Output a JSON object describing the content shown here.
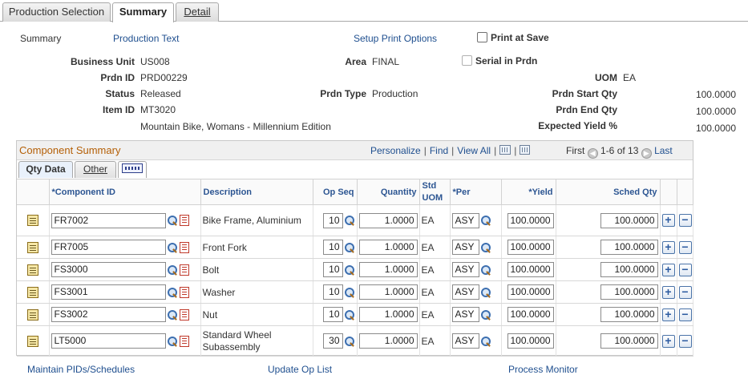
{
  "tabs": [
    {
      "label": "Production Selection",
      "active": false
    },
    {
      "label": "Summary",
      "active": true
    },
    {
      "label": "Detail",
      "active": false
    }
  ],
  "header_links": {
    "summary_label": "Summary",
    "production_text": "Production Text",
    "setup_print_options": "Setup Print Options",
    "print_at_save": "Print at Save",
    "serial_in_prdn": "Serial in Prdn"
  },
  "fields": {
    "business_unit_label": "Business Unit",
    "business_unit": "US008",
    "prdn_id_label": "Prdn ID",
    "prdn_id": "PRD00229",
    "status_label": "Status",
    "status": "Released",
    "item_id_label": "Item ID",
    "item_id": "MT3020",
    "item_description": "Mountain Bike, Womans - Millennium Edition",
    "area_label": "Area",
    "area": "FINAL",
    "prdn_type_label": "Prdn Type",
    "prdn_type": "Production",
    "uom_label": "UOM",
    "uom": "EA",
    "start_qty_label": "Prdn Start Qty",
    "start_qty": "100.0000",
    "end_qty_label": "Prdn End Qty",
    "end_qty": "100.0000",
    "yield_label": "Expected Yield %",
    "yield": "100.0000"
  },
  "grid": {
    "title": "Component Summary",
    "personalize": "Personalize",
    "find": "Find",
    "view_all": "View All",
    "first": "First",
    "range": "1-6 of 13",
    "last": "Last",
    "subtabs": [
      {
        "label": "Qty Data",
        "active": true
      },
      {
        "label": "Other",
        "active": false
      }
    ],
    "columns": {
      "component_id": "*Component ID",
      "description": "Description",
      "op_seq": "Op Seq",
      "quantity": "Quantity",
      "std_uom": "Std UOM",
      "per": "*Per",
      "yield": "*Yield",
      "sched_qty": "Sched Qty"
    },
    "rows": [
      {
        "component_id": "FR7002",
        "description": "Bike Frame, Aluminium",
        "op_seq": "10",
        "quantity": "1.0000",
        "uom": "EA",
        "per": "ASY",
        "yield": "100.0000",
        "sched_qty": "100.0000"
      },
      {
        "component_id": "FR7005",
        "description": "Front Fork",
        "op_seq": "10",
        "quantity": "1.0000",
        "uom": "EA",
        "per": "ASY",
        "yield": "100.0000",
        "sched_qty": "100.0000"
      },
      {
        "component_id": "FS3000",
        "description": "Bolt",
        "op_seq": "10",
        "quantity": "1.0000",
        "uom": "EA",
        "per": "ASY",
        "yield": "100.0000",
        "sched_qty": "100.0000"
      },
      {
        "component_id": "FS3001",
        "description": "Washer",
        "op_seq": "10",
        "quantity": "1.0000",
        "uom": "EA",
        "per": "ASY",
        "yield": "100.0000",
        "sched_qty": "100.0000"
      },
      {
        "component_id": "FS3002",
        "description": "Nut",
        "op_seq": "10",
        "quantity": "1.0000",
        "uom": "EA",
        "per": "ASY",
        "yield": "100.0000",
        "sched_qty": "100.0000"
      },
      {
        "component_id": "LT5000",
        "description": "Standard Wheel Subassembly",
        "op_seq": "30",
        "quantity": "1.0000",
        "uom": "EA",
        "per": "ASY",
        "yield": "100.0000",
        "sched_qty": "100.0000"
      }
    ]
  },
  "footer": {
    "maintain_pids": "Maintain PIDs/Schedules",
    "update_op_list": "Update Op List",
    "process_monitor": "Process Monitor"
  },
  "colors": {
    "link": "#1f4f8f",
    "grid_title": "#b45f06",
    "header_text": "#2c5592"
  }
}
